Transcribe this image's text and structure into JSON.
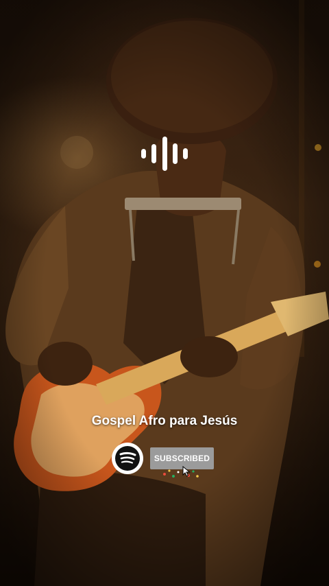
{
  "video": {
    "title": "Gospel Afro para Jesús"
  },
  "badges": {
    "spotify_icon": "spotify-logo",
    "audio_icon": "audio-wave"
  },
  "subscribe": {
    "label": "SUBSCRIBED"
  },
  "colors": {
    "overlay_text": "#ffffff",
    "subscribe_bg": "#9b9b9b",
    "spotify_badge_bg": "#ffffff",
    "scene_tone": "#3a2412"
  }
}
